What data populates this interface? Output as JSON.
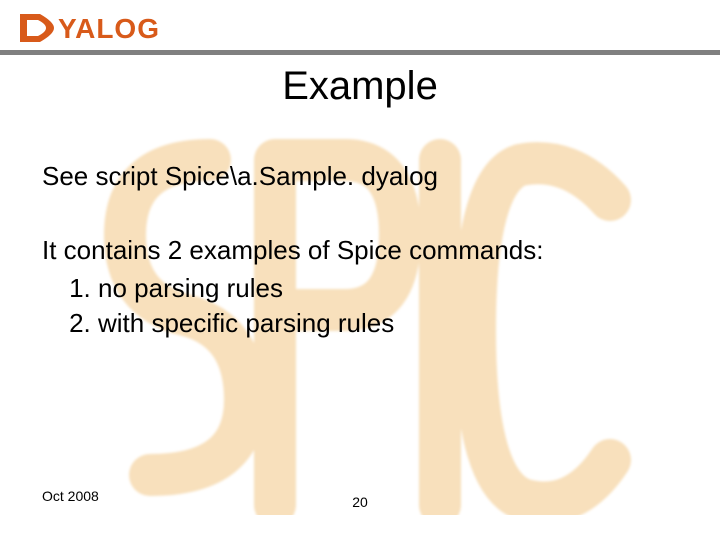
{
  "header": {
    "brand": "DYALOG",
    "title": "Example"
  },
  "body": {
    "intro": "See script Spice\\a.Sample. dyalog",
    "lead": "It contains 2 examples of Spice commands:",
    "items": [
      "no parsing rules",
      "with specific parsing rules"
    ]
  },
  "footer": {
    "date": "Oct  2008",
    "page": "20"
  },
  "watermark": "SPICE"
}
